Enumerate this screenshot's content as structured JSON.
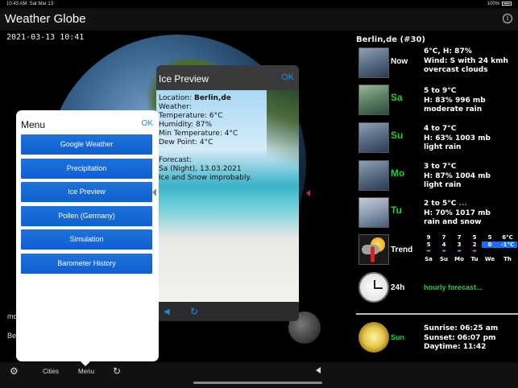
{
  "status": {
    "time": "10:43 AM",
    "date": "Sat Mar 13",
    "battery": "100%"
  },
  "header": {
    "title": "Weather Globe",
    "info_icon": "i"
  },
  "map": {
    "datestamp": "2021-03-13 10:41",
    "side_text_1": "mo",
    "side_text_2": "Be"
  },
  "ice_preview": {
    "title": "Ice Preview",
    "ok": "OK",
    "location_label": "Location: ",
    "location_value": "Berlin,de",
    "weather_label": "Weather:",
    "temperature": "Temperature: 6°C",
    "humidity": "Humidity: 87%",
    "min_temperature": "Min Temperature: 4°C",
    "dew_point": "Dew Point: 4°C",
    "forecast_label": "Forecast:",
    "forecast_line_1": "Sa (Night), 13.03.2021",
    "forecast_line_2": "Ice and Snow improbably."
  },
  "menu": {
    "title": "Menu",
    "ok": "OK",
    "items": [
      "Google Weather",
      "Precipitation",
      "Ice Preview",
      "Pollen (Germany)",
      "Simulation",
      "Barometer History"
    ]
  },
  "forecast": {
    "location": "Berlin,de (#30)",
    "rows": [
      {
        "day": "Now",
        "line1": "6°C, H: 87%",
        "line2": "Wind: S with 24 kmh",
        "line3": "overcast clouds"
      },
      {
        "day": "Sa",
        "line1": "5 to 9°C",
        "line2": "H: 83% 996 mb",
        "line3": "moderate rain"
      },
      {
        "day": "Su",
        "line1": "4 to 7°C",
        "line2": "H: 63% 1003 mb",
        "line3": "light rain"
      },
      {
        "day": "Mo",
        "line1": "3 to 7°C",
        "line2": "H: 87% 1004 mb",
        "line3": "light rain"
      },
      {
        "day": "Tu",
        "line1": "2 to 5°C",
        "line1_extra": " ...",
        "line2": "H: 70% 1017 mb",
        "line3": "rain and snow"
      }
    ],
    "trend": {
      "label": "Trend",
      "highs": [
        "9",
        "7",
        "7",
        "5",
        "5",
        "6°C"
      ],
      "lows": [
        "5",
        "4",
        "3",
        "2",
        "0",
        "-1°C"
      ],
      "days": [
        "Sa",
        "Su",
        "Mo",
        "Tu",
        "We",
        "Th"
      ]
    },
    "hourly": {
      "label": "24h",
      "link": "hourly forecast..."
    },
    "sun": {
      "label": "Sun",
      "sunrise": "Sunrise: 06:25 am",
      "sunset": "Sunset: 06:07 pm",
      "daytime": "Daytime: 11:42"
    }
  },
  "toolbar": {
    "cities": "Cities",
    "menu": "Menu"
  }
}
